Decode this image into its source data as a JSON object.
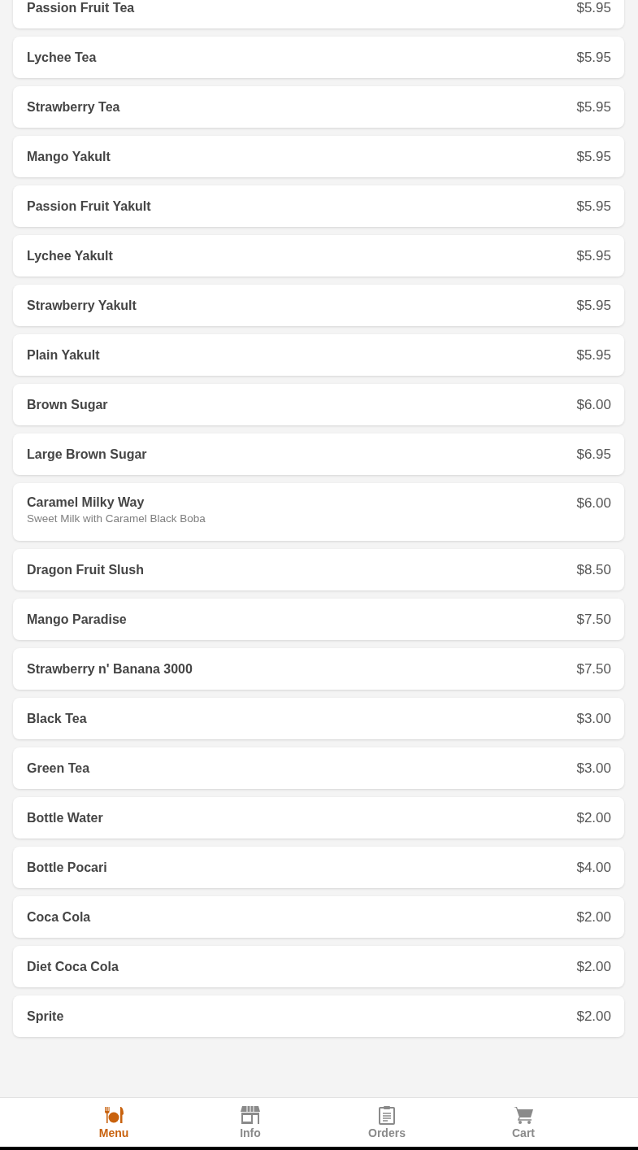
{
  "menu_items": [
    {
      "name": "Passion Fruit Tea",
      "price": "$5.95"
    },
    {
      "name": "Lychee Tea",
      "price": "$5.95"
    },
    {
      "name": "Strawberry Tea",
      "price": "$5.95"
    },
    {
      "name": "Mango Yakult",
      "price": "$5.95"
    },
    {
      "name": "Passion Fruit Yakult",
      "price": "$5.95"
    },
    {
      "name": "Lychee Yakult",
      "price": "$5.95"
    },
    {
      "name": "Strawberry Yakult",
      "price": "$5.95"
    },
    {
      "name": "Plain Yakult",
      "price": "$5.95"
    },
    {
      "name": "Brown Sugar",
      "price": "$6.00"
    },
    {
      "name": "Large Brown Sugar",
      "price": "$6.95"
    },
    {
      "name": "Caramel Milky Way",
      "price": "$6.00",
      "description": "Sweet Milk with Caramel Black Boba"
    },
    {
      "name": "Dragon Fruit Slush",
      "price": "$8.50"
    },
    {
      "name": "Mango Paradise",
      "price": "$7.50"
    },
    {
      "name": "Strawberry n' Banana 3000",
      "price": "$7.50"
    },
    {
      "name": "Black Tea",
      "price": "$3.00"
    },
    {
      "name": "Green Tea",
      "price": "$3.00"
    },
    {
      "name": "Bottle Water",
      "price": "$2.00"
    },
    {
      "name": "Bottle Pocari",
      "price": "$4.00"
    },
    {
      "name": "Coca Cola",
      "price": "$2.00"
    },
    {
      "name": "Diet Coca Cola",
      "price": "$2.00"
    },
    {
      "name": "Sprite",
      "price": "$2.00"
    }
  ],
  "bottom_nav": [
    {
      "label": "Menu",
      "kind": "menu",
      "selected": true
    },
    {
      "label": "Info",
      "kind": "info",
      "selected": false
    },
    {
      "label": "Orders",
      "kind": "orders",
      "selected": false
    },
    {
      "label": "Cart",
      "kind": "cart",
      "selected": false
    }
  ]
}
